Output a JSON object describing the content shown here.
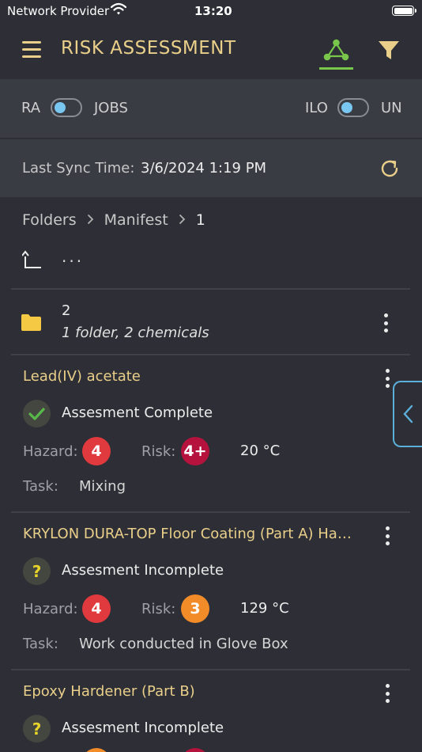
{
  "status_bar": {
    "carrier": "Network Provider",
    "time": "13:20"
  },
  "header": {
    "title": "RISK ASSESSMENT",
    "accent_color": "#e9cf8a",
    "active_tab_color": "#78c74a"
  },
  "toggles": {
    "left": {
      "off_label": "RA",
      "on_label": "JOBS"
    },
    "right": {
      "off_label": "ILO",
      "on_label": "UN"
    }
  },
  "sync": {
    "label": "Last Sync Time:",
    "value": "3/6/2024 1:19 PM"
  },
  "breadcrumb": {
    "items": [
      "Folders",
      "Manifest",
      "1"
    ]
  },
  "up_nav": {
    "label": "..."
  },
  "folder": {
    "name": "2",
    "description": "1 folder, 2 chemicals"
  },
  "chemicals": [
    {
      "name": "Lead(IV) acetate",
      "status": "Assesment Complete",
      "status_icon": "check-icon",
      "hazard_label": "Hazard:",
      "hazard": "4",
      "hazard_color": "#e0393e",
      "risk_label": "Risk:",
      "risk": "4+",
      "risk_color": "#b5123d",
      "temperature": "20 °C",
      "task_label": "Task:",
      "task": "Mixing"
    },
    {
      "name": "KRYLON DURA-TOP Floor Coating (Part A) Hazardous",
      "status": "Assesment Incomplete",
      "status_icon": "question-icon",
      "hazard_label": "Hazard:",
      "hazard": "4",
      "hazard_color": "#e0393e",
      "risk_label": "Risk:",
      "risk": "3",
      "risk_color": "#f28c28",
      "temperature": "129 °C",
      "task_label": "Task:",
      "task": "Work conducted in Glove Box"
    },
    {
      "name": "Epoxy Hardener (Part B)",
      "status": "Assesment Incomplete",
      "status_icon": "question-icon"
    }
  ]
}
